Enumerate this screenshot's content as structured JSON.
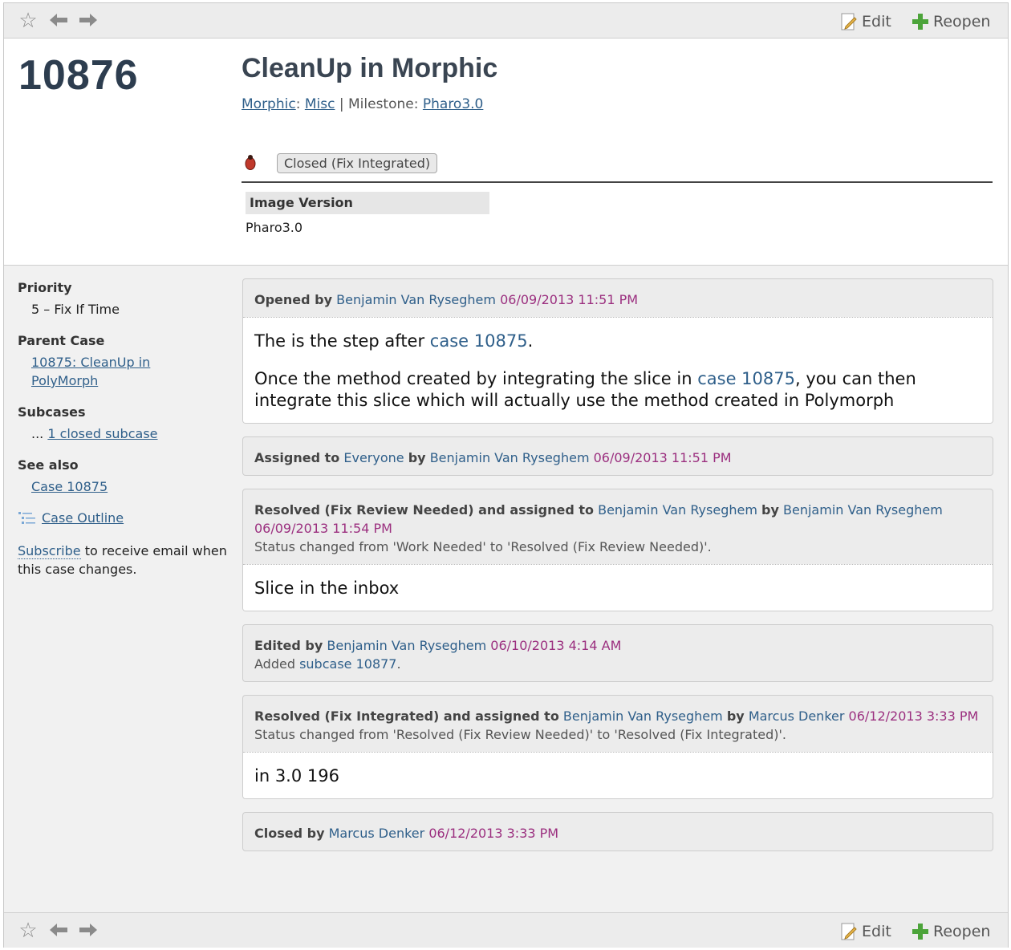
{
  "toolbar": {
    "edit_label": "Edit",
    "reopen_label": "Reopen"
  },
  "case": {
    "number": "10876",
    "title": "CleanUp in Morphic",
    "project": "Morphic",
    "area": "Misc",
    "milestone_label": "Milestone:",
    "milestone": "Pharo3.0",
    "status": "Closed (Fix Integrated)",
    "field_label": "Image Version",
    "field_value": "Pharo3.0"
  },
  "sidebar": {
    "priority_label": "Priority",
    "priority_value": "5 – Fix If Time",
    "parent_label": "Parent Case",
    "parent_value": "10875: CleanUp in PolyMorph",
    "subcases_label": "Subcases",
    "subcases_prefix": "...",
    "subcases_link": "1 closed subcase",
    "seealso_label": "See also",
    "seealso_link": "Case 10875",
    "outline_link": "Case Outline",
    "subscribe_link": "Subscribe",
    "subscribe_text": "to receive email when this case changes."
  },
  "events": [
    {
      "action": "Opened by",
      "user": "Benjamin Van Ryseghem",
      "time": "06/09/2013 11:51 PM",
      "body_1a": "The is the step after",
      "body_1link": "case 10875",
      "body_1b": ".",
      "body_2a": "Once the method created by integrating the slice in",
      "body_2link": "case 10875",
      "body_2b": ", you can then integrate this slice which will actually use the method created in Polymorph"
    },
    {
      "action": "Assigned to",
      "assignee": "Everyone",
      "by": "by",
      "user": "Benjamin Van Ryseghem",
      "time": "06/09/2013 11:51 PM"
    },
    {
      "action": "Resolved (Fix Review Needed) and assigned to",
      "assignee": "Benjamin Van Ryseghem",
      "by": "by",
      "user": "Benjamin Van Ryseghem",
      "time": "06/09/2013 11:54 PM",
      "sub": "Status changed from 'Work Needed' to 'Resolved (Fix Review Needed)'.",
      "body": "Slice in the inbox"
    },
    {
      "action": "Edited by",
      "user": "Benjamin Van Ryseghem",
      "time": "06/10/2013 4:14 AM",
      "sub_a": "Added",
      "sub_link": "subcase 10877",
      "sub_b": "."
    },
    {
      "action": "Resolved (Fix Integrated) and assigned to",
      "assignee": "Benjamin Van Ryseghem",
      "by": "by",
      "user": "Marcus Denker",
      "time": "06/12/2013 3:33 PM",
      "sub": "Status changed from 'Resolved (Fix Review Needed)' to 'Resolved (Fix Integrated)'.",
      "body": "in 3.0 196"
    },
    {
      "action": "Closed by",
      "user": "Marcus Denker",
      "time": "06/12/2013 3:33 PM"
    }
  ]
}
